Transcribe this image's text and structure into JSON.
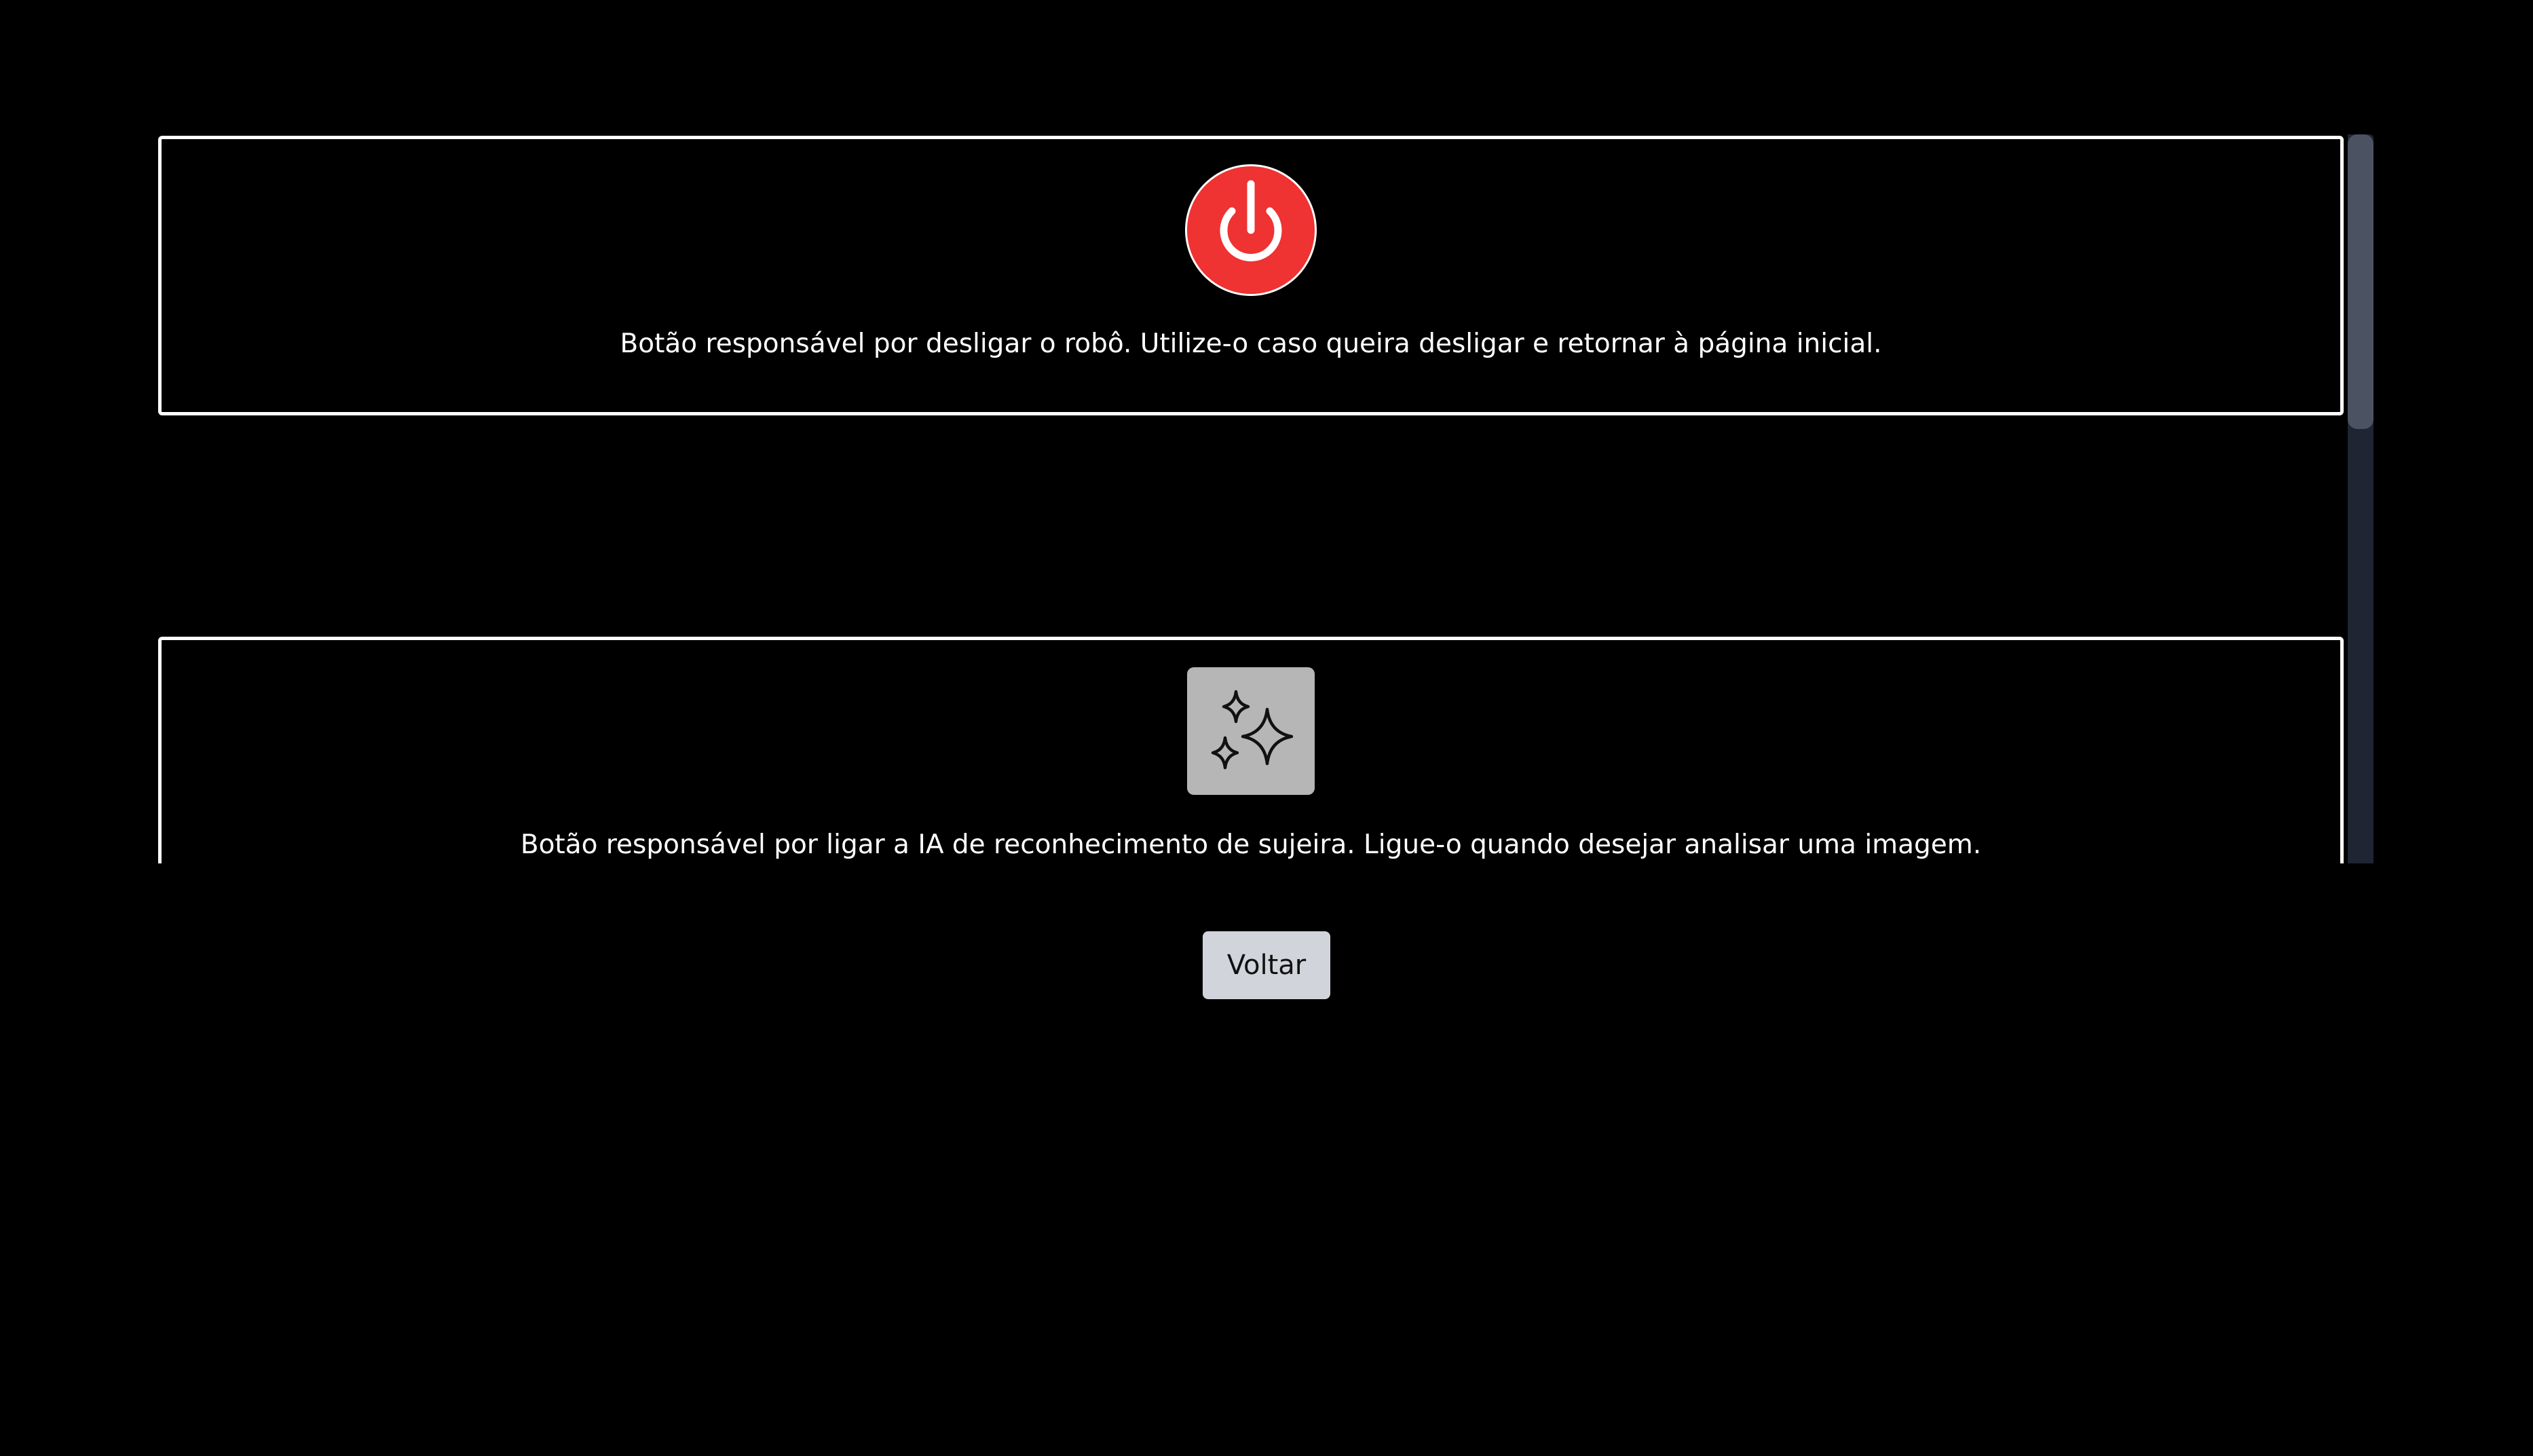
{
  "help_cards": [
    {
      "icon": "power-icon",
      "button_color": "#ef3232",
      "description": "Botão responsável por desligar o robô. Utilize-o caso queira desligar e retornar à página inicial."
    },
    {
      "icon": "sparkles-icon",
      "button_color": "#b6b6b6",
      "description": "Botão responsável por ligar a IA de reconhecimento de sujeira. Ligue-o quando desejar analisar uma imagem."
    }
  ],
  "footer": {
    "back_label": "Voltar"
  },
  "colors": {
    "background": "#000000",
    "card_border": "#ffffff",
    "scrollbar_track": "#1f2533",
    "scrollbar_thumb": "#4b5262",
    "back_button": "#d1d4da"
  }
}
